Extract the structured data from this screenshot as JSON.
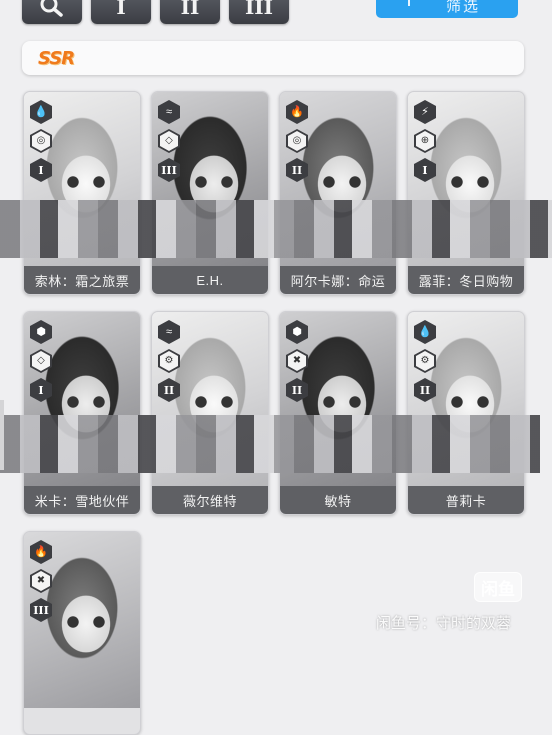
{
  "toolbar": {
    "search_icon": "search-icon",
    "rank_buttons": [
      "I",
      "II",
      "III"
    ],
    "filter": {
      "icon": "filter-icon",
      "label": "筛选"
    }
  },
  "section": {
    "rarity": "SSR"
  },
  "cards": [
    {
      "name": "索林：霜之旅票",
      "element": "water-drop-icon",
      "class": "target-icon",
      "rank": "I"
    },
    {
      "name": "E.H.",
      "element": "wind-icon",
      "class": "shield-icon",
      "rank": "III"
    },
    {
      "name": "阿尔卡娜：命运",
      "element": "fire-icon",
      "class": "target-icon",
      "rank": "II"
    },
    {
      "name": "露菲：冬日购物",
      "element": "lightning-icon",
      "class": "crosshair-icon",
      "rank": "I"
    },
    {
      "name": "米卡：雪地伙伴",
      "element": "iron-icon",
      "class": "shield-icon",
      "rank": "I"
    },
    {
      "name": "薇尔维特",
      "element": "wind-icon",
      "class": "gear-icon",
      "rank": "II"
    },
    {
      "name": "敏特",
      "element": "iron-icon",
      "class": "cross-icon",
      "rank": "II"
    },
    {
      "name": "普莉卡",
      "element": "water-drop-icon",
      "class": "gear-icon",
      "rank": "II"
    },
    {
      "name": "",
      "element": "fire-icon",
      "class": "cross-icon",
      "rank": "III"
    }
  ],
  "watermark": {
    "logo": "闲鱼",
    "text": "闲鱼号：守时的双蓉"
  },
  "colors": {
    "filter_button": "#2aa1f0",
    "ssr_text": "#f07a1c",
    "name_strip": "#5f6064"
  }
}
